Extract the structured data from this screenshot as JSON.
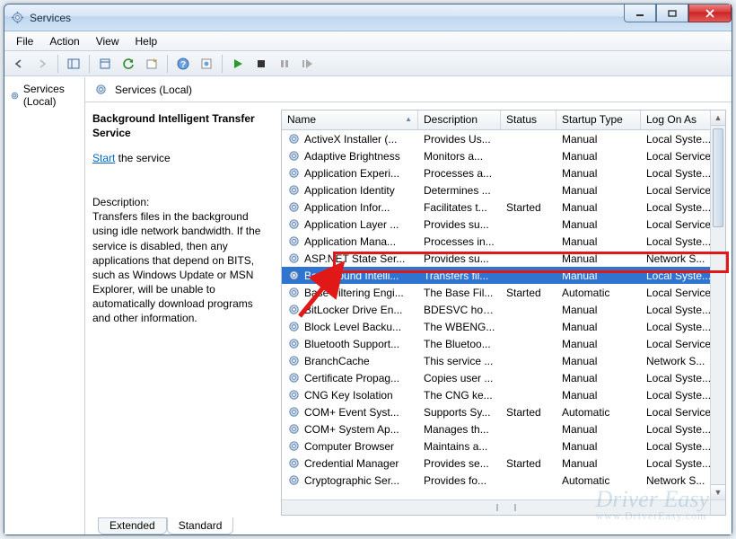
{
  "window": {
    "title": "Services"
  },
  "menu": [
    "File",
    "Action",
    "View",
    "Help"
  ],
  "tree": {
    "root": "Services (Local)"
  },
  "right_header": "Services (Local)",
  "detail": {
    "name": "Background Intelligent Transfer Service",
    "action_label": "Start",
    "action_suffix": " the service",
    "desc_heading": "Description:",
    "desc_text": "Transfers files in the background using idle network bandwidth. If the service is disabled, then any applications that depend on BITS, such as Windows Update or MSN Explorer, will be unable to automatically download programs and other information."
  },
  "columns": [
    "Name",
    "Description",
    "Status",
    "Startup Type",
    "Log On As"
  ],
  "services": [
    {
      "name": "ActiveX Installer (...",
      "desc": "Provides Us...",
      "status": "",
      "startup": "Manual",
      "logon": "Local Syste..."
    },
    {
      "name": "Adaptive Brightness",
      "desc": "Monitors a...",
      "status": "",
      "startup": "Manual",
      "logon": "Local Service"
    },
    {
      "name": "Application Experi...",
      "desc": "Processes a...",
      "status": "",
      "startup": "Manual",
      "logon": "Local Syste..."
    },
    {
      "name": "Application Identity",
      "desc": "Determines ...",
      "status": "",
      "startup": "Manual",
      "logon": "Local Service"
    },
    {
      "name": "Application Infor...",
      "desc": "Facilitates t...",
      "status": "Started",
      "startup": "Manual",
      "logon": "Local Syste..."
    },
    {
      "name": "Application Layer ...",
      "desc": "Provides su...",
      "status": "",
      "startup": "Manual",
      "logon": "Local Service"
    },
    {
      "name": "Application Mana...",
      "desc": "Processes in...",
      "status": "",
      "startup": "Manual",
      "logon": "Local Syste..."
    },
    {
      "name": "ASP.NET State Ser...",
      "desc": "Provides su...",
      "status": "",
      "startup": "Manual",
      "logon": "Network S..."
    },
    {
      "name": "Background Intelli...",
      "desc": "Transfers fil...",
      "status": "",
      "startup": "Manual",
      "logon": "Local Syste...",
      "selected": true
    },
    {
      "name": "Base Filtering Engi...",
      "desc": "The Base Fil...",
      "status": "Started",
      "startup": "Automatic",
      "logon": "Local Service"
    },
    {
      "name": "BitLocker Drive En...",
      "desc": "BDESVC hos...",
      "status": "",
      "startup": "Manual",
      "logon": "Local Syste..."
    },
    {
      "name": "Block Level Backu...",
      "desc": "The WBENG...",
      "status": "",
      "startup": "Manual",
      "logon": "Local Syste..."
    },
    {
      "name": "Bluetooth Support...",
      "desc": "The Bluetoo...",
      "status": "",
      "startup": "Manual",
      "logon": "Local Service"
    },
    {
      "name": "BranchCache",
      "desc": "This service ...",
      "status": "",
      "startup": "Manual",
      "logon": "Network S..."
    },
    {
      "name": "Certificate Propag...",
      "desc": "Copies user ...",
      "status": "",
      "startup": "Manual",
      "logon": "Local Syste..."
    },
    {
      "name": "CNG Key Isolation",
      "desc": "The CNG ke...",
      "status": "",
      "startup": "Manual",
      "logon": "Local Syste..."
    },
    {
      "name": "COM+ Event Syst...",
      "desc": "Supports Sy...",
      "status": "Started",
      "startup": "Automatic",
      "logon": "Local Service"
    },
    {
      "name": "COM+ System Ap...",
      "desc": "Manages th...",
      "status": "",
      "startup": "Manual",
      "logon": "Local Syste..."
    },
    {
      "name": "Computer Browser",
      "desc": "Maintains a...",
      "status": "",
      "startup": "Manual",
      "logon": "Local Syste..."
    },
    {
      "name": "Credential Manager",
      "desc": "Provides se...",
      "status": "Started",
      "startup": "Manual",
      "logon": "Local Syste..."
    },
    {
      "name": "Cryptographic Ser...",
      "desc": "Provides fo...",
      "status": "",
      "startup": "Automatic",
      "logon": "Network S..."
    }
  ],
  "tabs": {
    "extended": "Extended",
    "standard": "Standard",
    "active": "standard"
  },
  "watermark": {
    "brand": "Driver Easy",
    "url": "www.DriverEasy.com"
  }
}
